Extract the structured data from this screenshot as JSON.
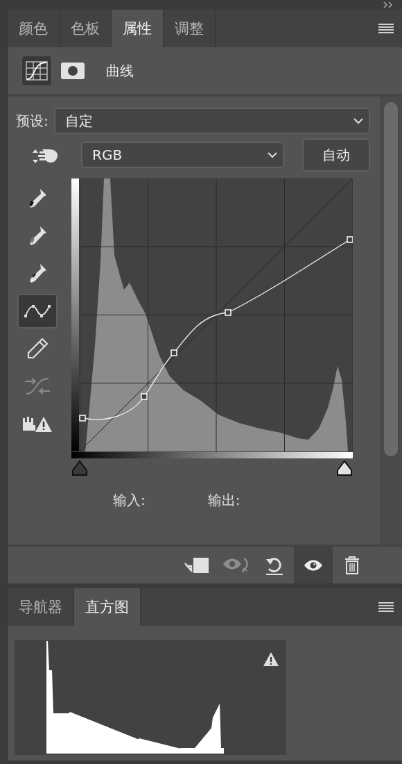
{
  "top_tabs": [
    {
      "label": "颜色",
      "selected": false
    },
    {
      "label": "色板",
      "selected": false
    },
    {
      "label": "属性",
      "selected": true
    },
    {
      "label": "调整",
      "selected": false
    }
  ],
  "properties": {
    "title": "曲线",
    "curve_view_selected": true,
    "preset": {
      "label": "预设:",
      "value": "自定"
    },
    "channel": {
      "value": "RGB"
    },
    "auto_button": "自动",
    "tools": [
      {
        "selected": false,
        "disabled": false
      },
      {
        "selected": false,
        "disabled": false
      },
      {
        "selected": false,
        "disabled": false
      },
      {
        "selected": true,
        "disabled": false
      },
      {
        "selected": false,
        "disabled": false
      },
      {
        "selected": false,
        "disabled": true
      },
      {
        "selected": false,
        "disabled": false
      }
    ],
    "input_sliders": [
      {
        "level": 0
      },
      {
        "level": 1
      }
    ],
    "input_label": "输入:",
    "output_label": "输出:",
    "footer_buttons": [
      {
        "selected": false,
        "disabled": false
      },
      {
        "selected": false,
        "disabled": true
      },
      {
        "selected": false,
        "disabled": false
      },
      {
        "selected": true,
        "disabled": false
      },
      {
        "selected": false,
        "disabled": false
      }
    ]
  },
  "bottom_tabs": [
    {
      "label": "导航器",
      "selected": false
    },
    {
      "label": "直方图",
      "selected": true
    }
  ]
}
